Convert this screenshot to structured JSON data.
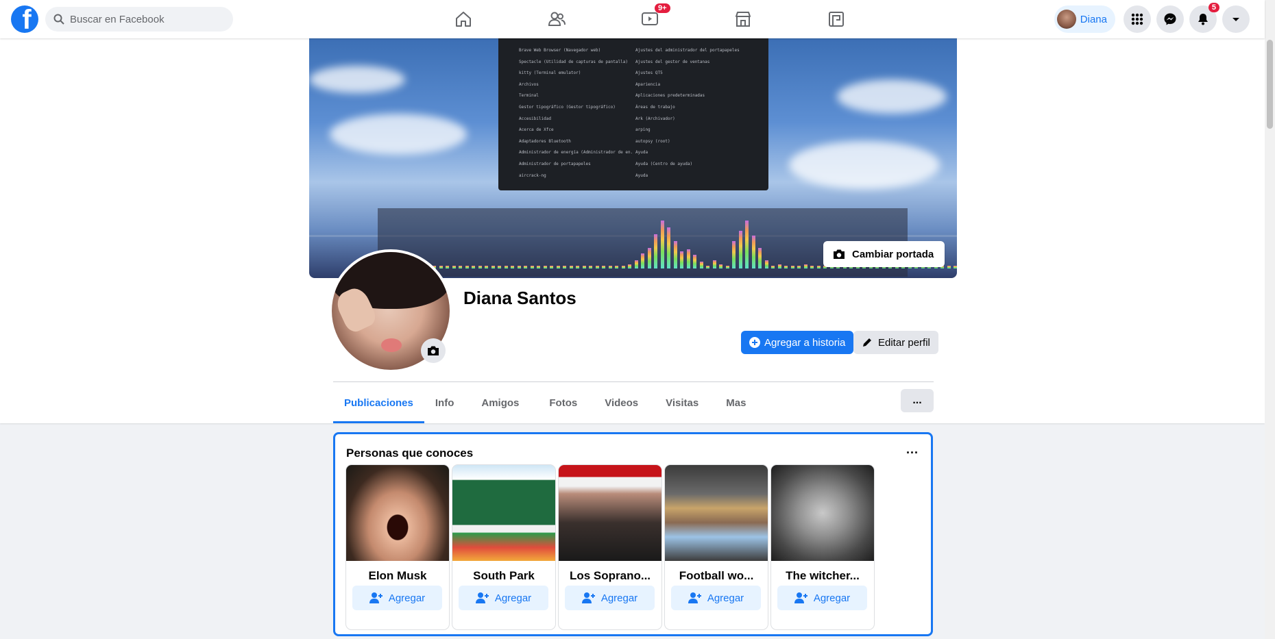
{
  "topbar": {
    "logo": "f",
    "search_placeholder": "Buscar en Facebook",
    "nav": [
      {
        "icon": "home-icon"
      },
      {
        "icon": "friends-icon"
      },
      {
        "icon": "watch-icon",
        "badge": "9+"
      },
      {
        "icon": "marketplace-icon"
      },
      {
        "icon": "gaming-icon"
      }
    ],
    "user_name": "Diana",
    "notifications_badge": "5"
  },
  "cover": {
    "change_label": "Cambiar portada",
    "menu_left": [
      "Brave Web Browser (Navegador web)",
      "Spectacle (Utilidad de capturas de pantalla)",
      "kitty (Terminal emulator)",
      "Archivos",
      "Terminal",
      "Gestor tipográfico (Gestor tipográfico)",
      "Accesibilidad",
      "Acerca de Xfce",
      "Adaptadores Bluetooth",
      "Administrador de energía (Administrador de en.",
      "Administrador de portapapeles",
      "aircrack-ng"
    ],
    "menu_right": [
      "Ajustes del administrador del portapapeles",
      "Ajustes del gestor de ventanas",
      "Ajustes QT5",
      "Apariencia",
      "Aplicaciones predeterminadas",
      "Áreas de trabajo",
      "Ark (Archivador)",
      "arping",
      "autopsy (root)",
      "Ayuda",
      "Ayuda (Centro de ayuda)",
      "Ayuda"
    ]
  },
  "profile": {
    "name": "Diana Santos",
    "add_story_label": "Agregar a historia",
    "edit_label": "Editar perfil"
  },
  "tabs": [
    "Publicaciones",
    "Info",
    "Amigos",
    "Fotos",
    "Videos",
    "Visitas",
    "Mas"
  ],
  "tabs_more": "...",
  "pymk": {
    "title": "Personas que conoces",
    "more": "...",
    "add_label": "Agregar",
    "people": [
      {
        "name": "Elon Musk"
      },
      {
        "name": "South Park"
      },
      {
        "name": "Los Soprano..."
      },
      {
        "name": "Football wo..."
      },
      {
        "name": "The witcher..."
      }
    ]
  },
  "colors": {
    "accent": "#1877f2",
    "badge": "#e41e3f",
    "page_bg": "#f0f2f5"
  }
}
